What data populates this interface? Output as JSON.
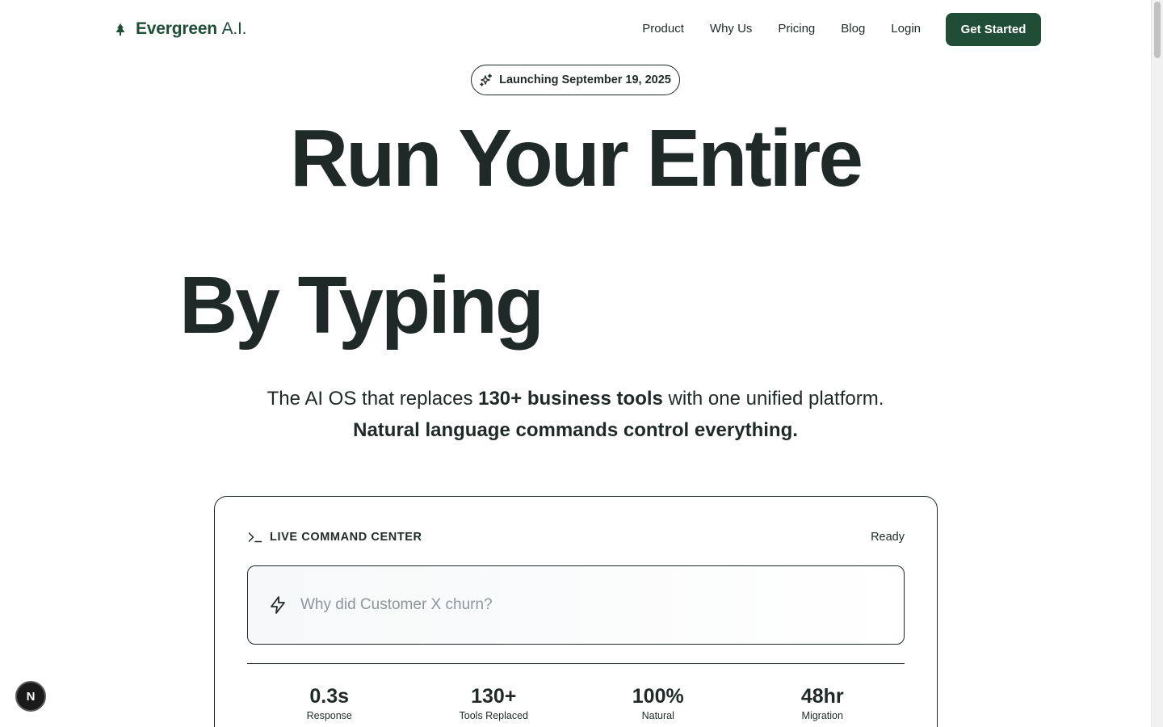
{
  "header": {
    "brand_bold": "Evergreen",
    "brand_light": "A.I.",
    "brand_icon": "tree-icon",
    "nav": [
      {
        "label": "Product"
      },
      {
        "label": "Why Us"
      },
      {
        "label": "Pricing"
      },
      {
        "label": "Blog"
      },
      {
        "label": "Login"
      }
    ],
    "cta_label": "Get Started"
  },
  "launch": {
    "icon": "sparkles-icon",
    "label": "Launching September 19, 2025"
  },
  "hero": {
    "line1": "Run Your Entire",
    "line2": "By Typing",
    "sub_1a": "The AI OS that replaces ",
    "sub_1b": "130+ business tools",
    "sub_1c": " with one unified platform.",
    "sub_2": "Natural language commands control everything."
  },
  "command_center": {
    "icon": "terminal-icon",
    "title": "LIVE COMMAND CENTER",
    "status": "Ready",
    "input_icon": "bolt-icon",
    "input_placeholder": "Why did Customer X churn?",
    "input_value": "",
    "stats": [
      {
        "value": "0.3s",
        "label": "Response"
      },
      {
        "value": "130+",
        "label": "Tools Replaced"
      },
      {
        "value": "100%",
        "label": "Natural"
      },
      {
        "value": "48hr",
        "label": "Migration"
      }
    ]
  },
  "badge": {
    "letter": "N"
  },
  "colors": {
    "brand_green": "#1f4d36",
    "text_dark": "#1f2a28",
    "placeholder_gray": "#8f9699",
    "badge_black": "#1a1a1a"
  }
}
